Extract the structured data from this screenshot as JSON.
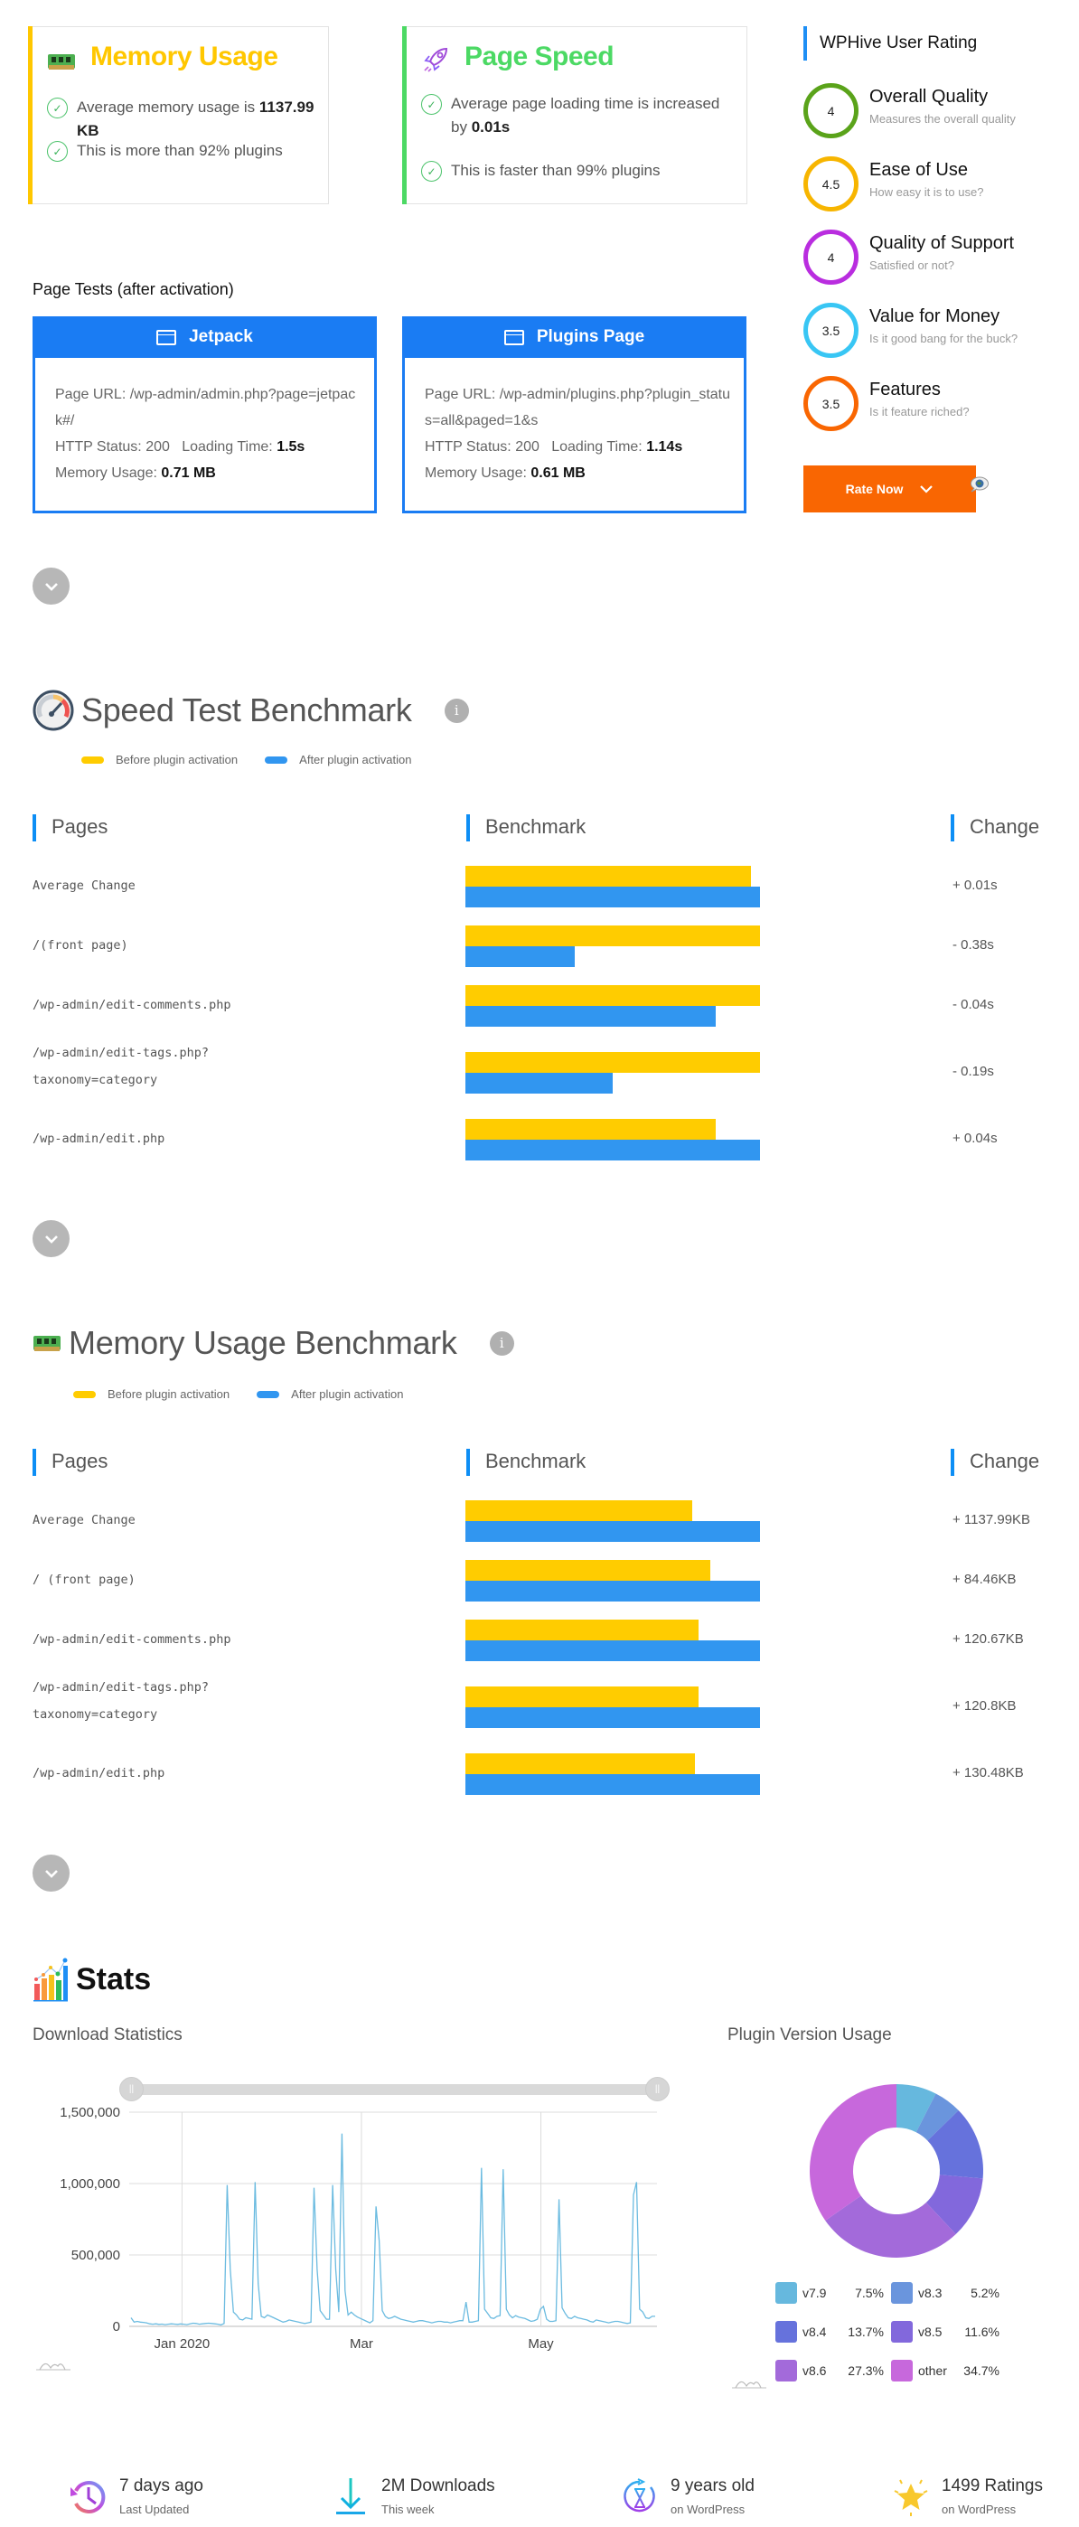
{
  "summary_cards": {
    "memory": {
      "title": "Memory Usage",
      "accent": "#ffc700",
      "line1_prefix": "Average memory usage is ",
      "line1_value": "1137.99 KB",
      "line2": "This is more than 92% plugins"
    },
    "speed": {
      "title": "Page Speed",
      "accent": "#4cd964",
      "line1_prefix": "Average page loading time is increased by ",
      "line1_value": "0.01s",
      "line2": "This is faster than 99% plugins"
    }
  },
  "rating": {
    "title": "WPHive User Rating",
    "items": [
      {
        "score": "4",
        "name": "Overall Quality",
        "desc": "Measures the overall quality",
        "color": "#5aa31a"
      },
      {
        "score": "4.5",
        "name": "Ease of Use",
        "desc": "How easy it is to use?",
        "color": "#f7b500"
      },
      {
        "score": "4",
        "name": "Quality of Support",
        "desc": "Satisfied or not?",
        "color": "#b92ddf"
      },
      {
        "score": "3.5",
        "name": "Value for Money",
        "desc": "Is it good bang for the buck?",
        "color": "#38c6f4"
      },
      {
        "score": "3.5",
        "name": "Features",
        "desc": "Is it feature riched?",
        "color": "#f96602"
      }
    ],
    "rate_button": "Rate Now"
  },
  "page_tests": {
    "title": "Page Tests (after activation)",
    "cards": [
      {
        "name": "Jetpack",
        "url_label": "Page URL: ",
        "url": "/wp-admin/admin.php?page=jetpack#/",
        "status_label": "HTTP Status: ",
        "status": "200",
        "time_label": "Loading Time: ",
        "time": "1.5s",
        "mem_label": "Memory Usage: ",
        "mem": "0.71 MB"
      },
      {
        "name": "Plugins Page",
        "url_label": "Page URL: ",
        "url": "/wp-admin/plugins.php?plugin_status=all&paged=1&s",
        "status_label": "HTTP Status: ",
        "status": "200",
        "time_label": "Loading Time: ",
        "time": "1.14s",
        "mem_label": "Memory Usage: ",
        "mem": "0.61 MB"
      }
    ]
  },
  "speed_benchmark": {
    "title": "Speed Test Benchmark",
    "legend_before": "Before plugin activation",
    "legend_after": "After plugin activation",
    "col_pages": "Pages",
    "col_benchmark": "Benchmark",
    "col_change": "Change",
    "rows": [
      {
        "page": "Average Change",
        "page2": "",
        "before": 0.97,
        "after": 1.0,
        "change": "+ 0.01s"
      },
      {
        "page": "/(front page)",
        "page2": "",
        "before": 1.0,
        "after": 0.37,
        "change": "- 0.38s"
      },
      {
        "page": "/wp-admin/edit-comments.php",
        "page2": "",
        "before": 1.0,
        "after": 0.85,
        "change": "- 0.04s"
      },
      {
        "page": "/wp-admin/edit-tags.php?",
        "page2": "taxonomy=category",
        "before": 1.0,
        "after": 0.5,
        "change": "- 0.19s"
      },
      {
        "page": "/wp-admin/edit.php",
        "page2": "",
        "before": 0.85,
        "after": 1.0,
        "change": "+ 0.04s"
      }
    ]
  },
  "memory_benchmark": {
    "title": "Memory Usage Benchmark",
    "legend_before": "Before plugin activation",
    "legend_after": "After plugin activation",
    "col_pages": "Pages",
    "col_benchmark": "Benchmark",
    "col_change": "Change",
    "rows": [
      {
        "page": "Average Change",
        "page2": "",
        "before": 0.77,
        "after": 1.0,
        "change": "+ 1137.99KB"
      },
      {
        "page": "/ (front page)",
        "page2": "",
        "before": 0.83,
        "after": 1.0,
        "change": "+ 84.46KB"
      },
      {
        "page": "/wp-admin/edit-comments.php",
        "page2": "",
        "before": 0.79,
        "after": 1.0,
        "change": "+ 120.67KB"
      },
      {
        "page": "/wp-admin/edit-tags.php?",
        "page2": "taxonomy=category",
        "before": 0.79,
        "after": 1.0,
        "change": "+ 120.8KB"
      },
      {
        "page": "/wp-admin/edit.php",
        "page2": "",
        "before": 0.78,
        "after": 1.0,
        "change": "+ 130.48KB"
      }
    ]
  },
  "stats": {
    "title": "Stats",
    "download_title": "Download Statistics",
    "version_title": "Plugin Version Usage"
  },
  "chart_data": [
    {
      "type": "line",
      "title": "Download Statistics",
      "xlabel": "",
      "ylabel": "",
      "ylim": [
        0,
        1500000
      ],
      "y_ticks": [
        "0",
        "500,000",
        "1,000,000",
        "1,500,000"
      ],
      "y_tick_values": [
        0,
        500000,
        1000000,
        1500000
      ],
      "x_ticks": [
        "Jan 2020",
        "Mar",
        "May"
      ],
      "x_tick_positions": [
        0.1,
        0.44,
        0.78
      ],
      "grid": true,
      "color": "#6bbbe0",
      "series": [
        {
          "name": "downloads",
          "values": [
            60000,
            30000,
            35000,
            30000,
            28000,
            25000,
            18000,
            15000,
            18000,
            14000,
            16000,
            12000,
            15000,
            18000,
            16000,
            14000,
            17000,
            15000,
            12000,
            18000,
            22000,
            20000,
            15000,
            18000,
            20000,
            22000,
            20000,
            18000,
            15000,
            10000,
            20000,
            990000,
            400000,
            100000,
            80000,
            50000,
            45000,
            60000,
            55000,
            50000,
            1010000,
            300000,
            70000,
            60000,
            80000,
            70000,
            60000,
            50000,
            40000,
            30000,
            35000,
            45000,
            40000,
            35000,
            30000,
            25000,
            20000,
            25000,
            30000,
            970000,
            400000,
            110000,
            80000,
            50000,
            50000,
            990000,
            400000,
            100000,
            1350000,
            250000,
            80000,
            100000,
            80000,
            65000,
            55000,
            45000,
            35000,
            25000,
            40000,
            840000,
            600000,
            110000,
            70000,
            55000,
            60000,
            70000,
            60000,
            50000,
            45000,
            40000,
            35000,
            30000,
            35000,
            40000,
            40000,
            35000,
            30000,
            25000,
            30000,
            35000,
            35000,
            30000,
            30000,
            25000,
            30000,
            35000,
            40000,
            40000,
            170000,
            30000,
            30000,
            35000,
            40000,
            1110000,
            120000,
            90000,
            60000,
            55000,
            70000,
            75000,
            1100000,
            120000,
            80000,
            60000,
            75000,
            65000,
            60000,
            55000,
            45000,
            35000,
            40000,
            50000,
            120000,
            140000,
            50000,
            35000,
            35000,
            40000,
            890000,
            130000,
            90000,
            60000,
            55000,
            70000,
            60000,
            55000,
            50000,
            45000,
            35000,
            30000,
            45000,
            40000,
            35000,
            30000,
            25000,
            30000,
            35000,
            35000,
            30000,
            25000,
            20000,
            25000,
            920000,
            1010000,
            120000,
            100000,
            60000,
            55000,
            70000,
            70000
          ]
        }
      ]
    },
    {
      "type": "pie",
      "title": "Plugin Version Usage",
      "donut": true,
      "categories": [
        "v7.9",
        "v8.3",
        "v8.4",
        "v8.5",
        "v8.6",
        "other"
      ],
      "values": [
        7.5,
        5.2,
        13.7,
        11.6,
        27.3,
        34.7
      ],
      "labels": [
        "7.5%",
        "5.2%",
        "13.7%",
        "11.6%",
        "27.3%",
        "34.7%"
      ],
      "colors": [
        "#66b8de",
        "#6a95dd",
        "#6672dc",
        "#8268dc",
        "#a36ada",
        "#c768dc"
      ]
    }
  ],
  "footer_stats": [
    {
      "main": "7 days ago",
      "sub": "Last Updated",
      "icon": "clock-history-icon"
    },
    {
      "main": "2M Downloads",
      "sub": "This week",
      "icon": "download-icon"
    },
    {
      "main": "9 years old",
      "sub": "on WordPress",
      "icon": "hourglass-icon"
    },
    {
      "main": "1499 Ratings",
      "sub": "on WordPress",
      "icon": "star-icon"
    }
  ]
}
